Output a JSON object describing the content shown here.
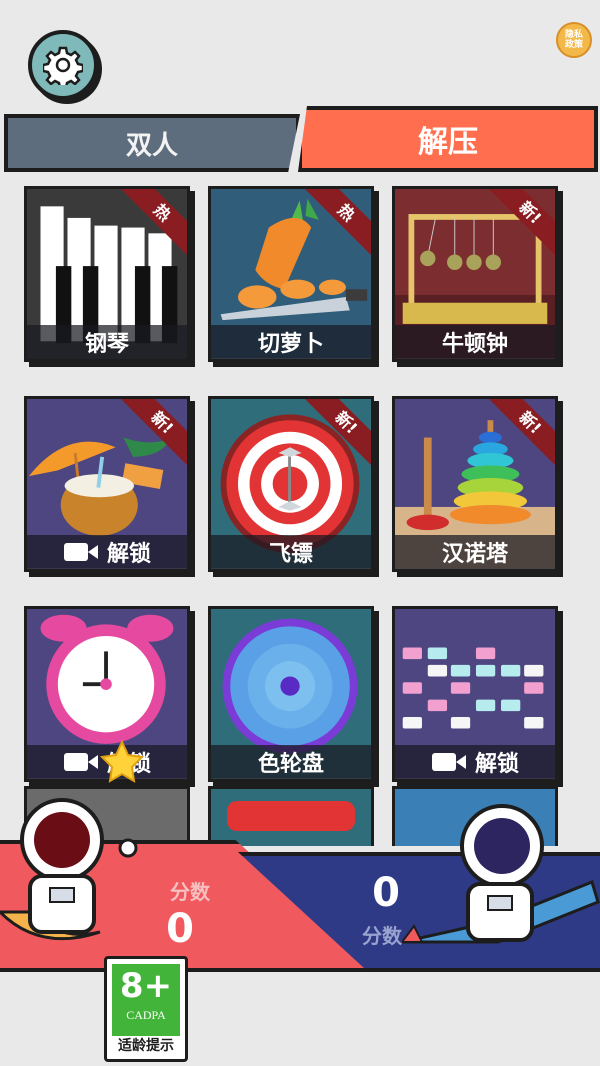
{
  "header": {
    "settings_icon": "gear-icon",
    "privacy_badge": [
      "隐私",
      "政策"
    ]
  },
  "tabs": [
    {
      "label": "双人",
      "active": false
    },
    {
      "label": "解压",
      "active": true
    }
  ],
  "games": [
    {
      "label": "钢琴",
      "ribbon": "热",
      "locked": false
    },
    {
      "label": "切萝卜",
      "ribbon": "热",
      "locked": false
    },
    {
      "label": "牛顿钟",
      "ribbon": "新!",
      "locked": false
    },
    {
      "label": "解锁",
      "ribbon": "新!",
      "locked": true
    },
    {
      "label": "飞镖",
      "ribbon": "新!",
      "locked": false
    },
    {
      "label": "汉诺塔",
      "ribbon": "新!",
      "locked": false
    },
    {
      "label": "解锁",
      "ribbon": "",
      "locked": true
    },
    {
      "label": "色轮盘",
      "ribbon": "",
      "locked": false
    },
    {
      "label": "解锁",
      "ribbon": "",
      "locked": true
    }
  ],
  "score": {
    "left_label": "分数",
    "left_value": "0",
    "right_label": "分数",
    "right_value": "0"
  },
  "age_rating": {
    "value": "8+",
    "org": "CADPA",
    "caption": "适龄提示"
  },
  "colors": {
    "tab_active": "#ff6f4f",
    "tab_inactive": "#5e6d7d",
    "score_left": "#f05a5e",
    "score_right": "#2e3a86",
    "ribbon": "#8a1d22"
  }
}
